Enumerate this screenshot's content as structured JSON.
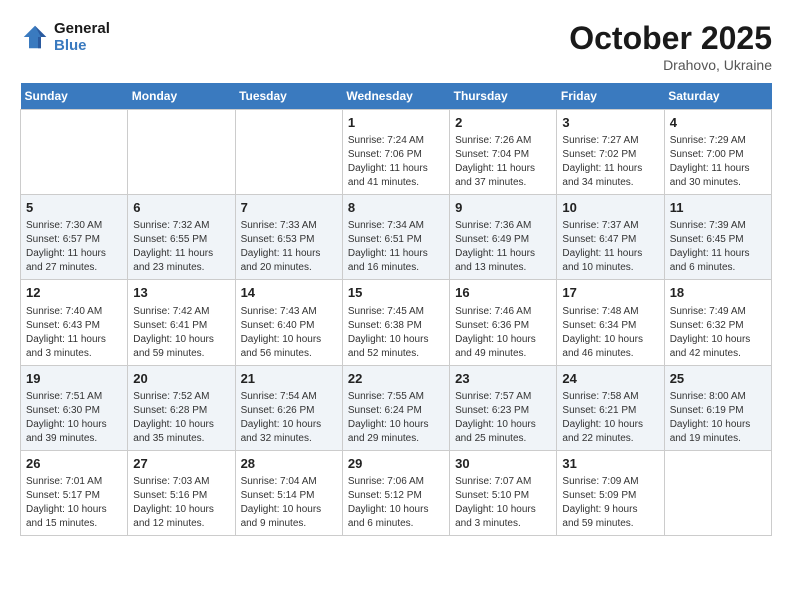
{
  "header": {
    "logo_line1": "General",
    "logo_line2": "Blue",
    "month": "October 2025",
    "location": "Drahovo, Ukraine"
  },
  "weekdays": [
    "Sunday",
    "Monday",
    "Tuesday",
    "Wednesday",
    "Thursday",
    "Friday",
    "Saturday"
  ],
  "weeks": [
    [
      {
        "day": "",
        "info": ""
      },
      {
        "day": "",
        "info": ""
      },
      {
        "day": "",
        "info": ""
      },
      {
        "day": "1",
        "info": "Sunrise: 7:24 AM\nSunset: 7:06 PM\nDaylight: 11 hours\nand 41 minutes."
      },
      {
        "day": "2",
        "info": "Sunrise: 7:26 AM\nSunset: 7:04 PM\nDaylight: 11 hours\nand 37 minutes."
      },
      {
        "day": "3",
        "info": "Sunrise: 7:27 AM\nSunset: 7:02 PM\nDaylight: 11 hours\nand 34 minutes."
      },
      {
        "day": "4",
        "info": "Sunrise: 7:29 AM\nSunset: 7:00 PM\nDaylight: 11 hours\nand 30 minutes."
      }
    ],
    [
      {
        "day": "5",
        "info": "Sunrise: 7:30 AM\nSunset: 6:57 PM\nDaylight: 11 hours\nand 27 minutes."
      },
      {
        "day": "6",
        "info": "Sunrise: 7:32 AM\nSunset: 6:55 PM\nDaylight: 11 hours\nand 23 minutes."
      },
      {
        "day": "7",
        "info": "Sunrise: 7:33 AM\nSunset: 6:53 PM\nDaylight: 11 hours\nand 20 minutes."
      },
      {
        "day": "8",
        "info": "Sunrise: 7:34 AM\nSunset: 6:51 PM\nDaylight: 11 hours\nand 16 minutes."
      },
      {
        "day": "9",
        "info": "Sunrise: 7:36 AM\nSunset: 6:49 PM\nDaylight: 11 hours\nand 13 minutes."
      },
      {
        "day": "10",
        "info": "Sunrise: 7:37 AM\nSunset: 6:47 PM\nDaylight: 11 hours\nand 10 minutes."
      },
      {
        "day": "11",
        "info": "Sunrise: 7:39 AM\nSunset: 6:45 PM\nDaylight: 11 hours\nand 6 minutes."
      }
    ],
    [
      {
        "day": "12",
        "info": "Sunrise: 7:40 AM\nSunset: 6:43 PM\nDaylight: 11 hours\nand 3 minutes."
      },
      {
        "day": "13",
        "info": "Sunrise: 7:42 AM\nSunset: 6:41 PM\nDaylight: 10 hours\nand 59 minutes."
      },
      {
        "day": "14",
        "info": "Sunrise: 7:43 AM\nSunset: 6:40 PM\nDaylight: 10 hours\nand 56 minutes."
      },
      {
        "day": "15",
        "info": "Sunrise: 7:45 AM\nSunset: 6:38 PM\nDaylight: 10 hours\nand 52 minutes."
      },
      {
        "day": "16",
        "info": "Sunrise: 7:46 AM\nSunset: 6:36 PM\nDaylight: 10 hours\nand 49 minutes."
      },
      {
        "day": "17",
        "info": "Sunrise: 7:48 AM\nSunset: 6:34 PM\nDaylight: 10 hours\nand 46 minutes."
      },
      {
        "day": "18",
        "info": "Sunrise: 7:49 AM\nSunset: 6:32 PM\nDaylight: 10 hours\nand 42 minutes."
      }
    ],
    [
      {
        "day": "19",
        "info": "Sunrise: 7:51 AM\nSunset: 6:30 PM\nDaylight: 10 hours\nand 39 minutes."
      },
      {
        "day": "20",
        "info": "Sunrise: 7:52 AM\nSunset: 6:28 PM\nDaylight: 10 hours\nand 35 minutes."
      },
      {
        "day": "21",
        "info": "Sunrise: 7:54 AM\nSunset: 6:26 PM\nDaylight: 10 hours\nand 32 minutes."
      },
      {
        "day": "22",
        "info": "Sunrise: 7:55 AM\nSunset: 6:24 PM\nDaylight: 10 hours\nand 29 minutes."
      },
      {
        "day": "23",
        "info": "Sunrise: 7:57 AM\nSunset: 6:23 PM\nDaylight: 10 hours\nand 25 minutes."
      },
      {
        "day": "24",
        "info": "Sunrise: 7:58 AM\nSunset: 6:21 PM\nDaylight: 10 hours\nand 22 minutes."
      },
      {
        "day": "25",
        "info": "Sunrise: 8:00 AM\nSunset: 6:19 PM\nDaylight: 10 hours\nand 19 minutes."
      }
    ],
    [
      {
        "day": "26",
        "info": "Sunrise: 7:01 AM\nSunset: 5:17 PM\nDaylight: 10 hours\nand 15 minutes."
      },
      {
        "day": "27",
        "info": "Sunrise: 7:03 AM\nSunset: 5:16 PM\nDaylight: 10 hours\nand 12 minutes."
      },
      {
        "day": "28",
        "info": "Sunrise: 7:04 AM\nSunset: 5:14 PM\nDaylight: 10 hours\nand 9 minutes."
      },
      {
        "day": "29",
        "info": "Sunrise: 7:06 AM\nSunset: 5:12 PM\nDaylight: 10 hours\nand 6 minutes."
      },
      {
        "day": "30",
        "info": "Sunrise: 7:07 AM\nSunset: 5:10 PM\nDaylight: 10 hours\nand 3 minutes."
      },
      {
        "day": "31",
        "info": "Sunrise: 7:09 AM\nSunset: 5:09 PM\nDaylight: 9 hours\nand 59 minutes."
      },
      {
        "day": "",
        "info": ""
      }
    ]
  ]
}
